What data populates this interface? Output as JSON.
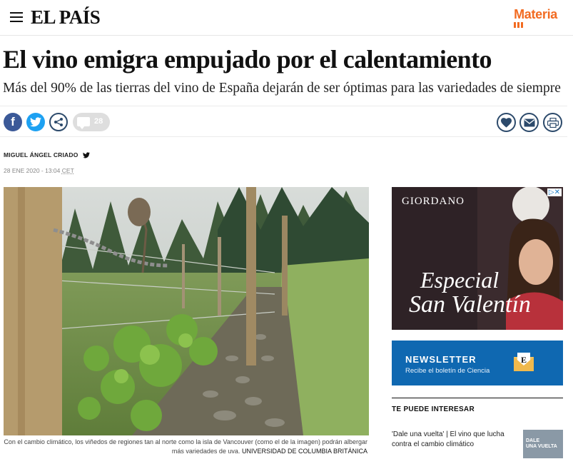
{
  "header": {
    "logo": "EL PAÍS",
    "section": "Materia"
  },
  "article": {
    "title": "El vino emigra empujado por el calentamiento",
    "subtitle": "Más del 90% de las tierras del vino de España dejarán de ser óptimas para las variedades de siempre",
    "author": "MIGUEL ÁNGEL CRIADO",
    "date": "28 ENE 2020 - 13:04",
    "timezone": "CET",
    "caption": "Con el cambio climático, los viñedos de regiones tan al norte como la isla de Vancouver (como el de la imagen) podrán albergar más variedades de uva.",
    "credit": "UNIVERSIDAD DE COLUMBIA BRITÁNICA"
  },
  "share": {
    "facebook_glyph": "f",
    "comment_count": "28"
  },
  "ad": {
    "brand": "GIORDANO",
    "line1": "Especial",
    "line2": "San Valentín"
  },
  "newsletter": {
    "title": "NEWSLETTER",
    "subtitle": "Recibe el boletín de Ciencia"
  },
  "related": {
    "heading": "TE PUEDE INTERESAR",
    "items": [
      {
        "text": "'Dale una vuelta' | El vino que lucha contra el cambio climático",
        "thumb_line1": "DALE",
        "thumb_line2": "UNA VUELTA"
      }
    ]
  },
  "colors": {
    "accent": "#f26b21",
    "facebook": "#3b5998",
    "twitter": "#1da1f2",
    "newsletter_bg": "#0f68b1",
    "icon_stroke": "#2c4a6b"
  }
}
